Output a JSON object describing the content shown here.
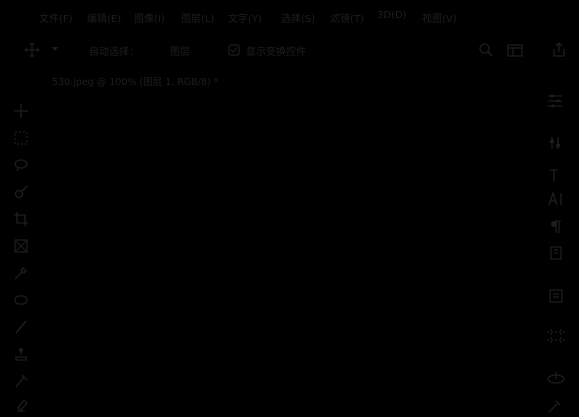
{
  "menubar": {
    "items": [
      {
        "label": "文件(F)"
      },
      {
        "label": "编辑(E)"
      },
      {
        "label": "图像(I)"
      },
      {
        "label": "图层(L)"
      },
      {
        "label": "文字(Y)"
      },
      {
        "label": "选择(S)"
      },
      {
        "label": "滤镜(T)"
      },
      {
        "label": "3D(D)"
      },
      {
        "label": "视图(V)"
      }
    ]
  },
  "options": {
    "auto_select_label": "自动选择：",
    "layer_dropdown_value": "图层",
    "show_transform_label": "显示变换控件"
  },
  "document": {
    "tab_title": "530.jpeg @ 100% (图层 1, RGB/8) *"
  },
  "tools": {
    "left": [
      {
        "icon": "move-tool-icon"
      },
      {
        "icon": "rectangular-marquee-icon"
      },
      {
        "icon": "lasso-icon"
      },
      {
        "icon": "quick-selection-icon"
      },
      {
        "icon": "crop-icon"
      },
      {
        "icon": "frame-icon"
      },
      {
        "icon": "eyedropper-icon"
      },
      {
        "icon": "healing-brush-icon"
      },
      {
        "icon": "brush-icon"
      },
      {
        "icon": "clone-stamp-icon"
      },
      {
        "icon": "history-brush-icon"
      },
      {
        "icon": "eraser-icon"
      }
    ],
    "right": [
      {
        "icon": "properties-icon"
      },
      {
        "icon": "adjustments-icon"
      },
      {
        "icon": "character-icon"
      },
      {
        "icon": "glyphs-icon"
      },
      {
        "icon": "paragraph-icon"
      },
      {
        "icon": "paragraph-styles-icon"
      },
      {
        "icon": "libraries-icon"
      },
      {
        "icon": "artboard-icon"
      },
      {
        "icon": "3d-icon"
      },
      {
        "icon": "brush-settings-icon"
      }
    ]
  },
  "colors": {
    "background": "#000000",
    "foreground_text": "#1e1e1e"
  }
}
